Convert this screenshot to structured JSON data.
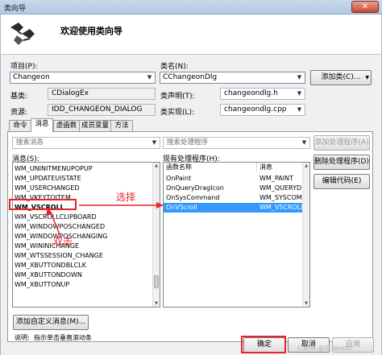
{
  "window": {
    "title": "类向导",
    "close_glyph": "✕"
  },
  "header": {
    "title": "欢迎使用类向导"
  },
  "project": {
    "label": "项目(P):",
    "value": "Changeon"
  },
  "class_name": {
    "label": "类名(N):",
    "value": "CChangeonDlg"
  },
  "add_class_button": {
    "label": "添加类(C)...",
    "arrow": "▼"
  },
  "base_class": {
    "label": "基类:",
    "value": "CDialogEx"
  },
  "class_declaration": {
    "label": "类声明(T):",
    "value": "changeondlg.h"
  },
  "resource": {
    "label": "资源:",
    "value": "IDD_CHANGEON_DIALOG"
  },
  "class_implementation": {
    "label": "类实现(L):",
    "value": "changeondlg.cpp"
  },
  "tabs": [
    {
      "label": "命令"
    },
    {
      "label": "消息"
    },
    {
      "label": "虚函数"
    },
    {
      "label": "成员变量"
    },
    {
      "label": "方法"
    }
  ],
  "search_messages": {
    "placeholder": "搜索消息"
  },
  "search_handlers": {
    "placeholder": "搜索处理程序"
  },
  "messages_label": "消息(S):",
  "existing_handlers_label": "现有处理程序(H):",
  "messages": [
    "WM_UNINITMENUPOPUP",
    "WM_UPDATEUISTATE",
    "WM_USERCHANGED",
    "WM_VKEYTOITEM",
    "WM_VSCROLL",
    "WM_VSCROLLCLIPBOARD",
    "WM_WINDOWPOSCHANGED",
    "WM_WINDOWPOSCHANGING",
    "WM_WININICHANGE",
    "WM_WTSSESSION_CHANGE",
    "WM_XBUTTONDBLCLK",
    "WM_XBUTTONDOWN",
    "WM_XBUTTONUP"
  ],
  "handlers_table": {
    "columns": [
      "函数名称",
      "消息"
    ],
    "rows": [
      [
        "OnPaint",
        "WM_PAINT"
      ],
      [
        "OnQueryDragIcon",
        "WM_QUERYD..."
      ],
      [
        "OnSysCommand",
        "WM_SYSCOM..."
      ],
      [
        "OnVScroll",
        "WM_VSCROLL"
      ]
    ],
    "selected_row": 3
  },
  "buttons": {
    "add_handler": "添加处理程序(A)",
    "delete_handler": "删除处理程序(D)",
    "edit_code": "编辑代码(E)",
    "add_custom_message": "添加自定义消息(M)...",
    "ok": "确定",
    "cancel": "取消",
    "apply": "应用"
  },
  "description": {
    "label": "说明:",
    "text": "指示单击垂直滚动条"
  },
  "annotations": {
    "select": "选择",
    "double_click": "双击"
  },
  "watermark": "CSDN @Sciassist",
  "colors": {
    "annotation": "#e8242b",
    "selection": "#3399ff"
  }
}
